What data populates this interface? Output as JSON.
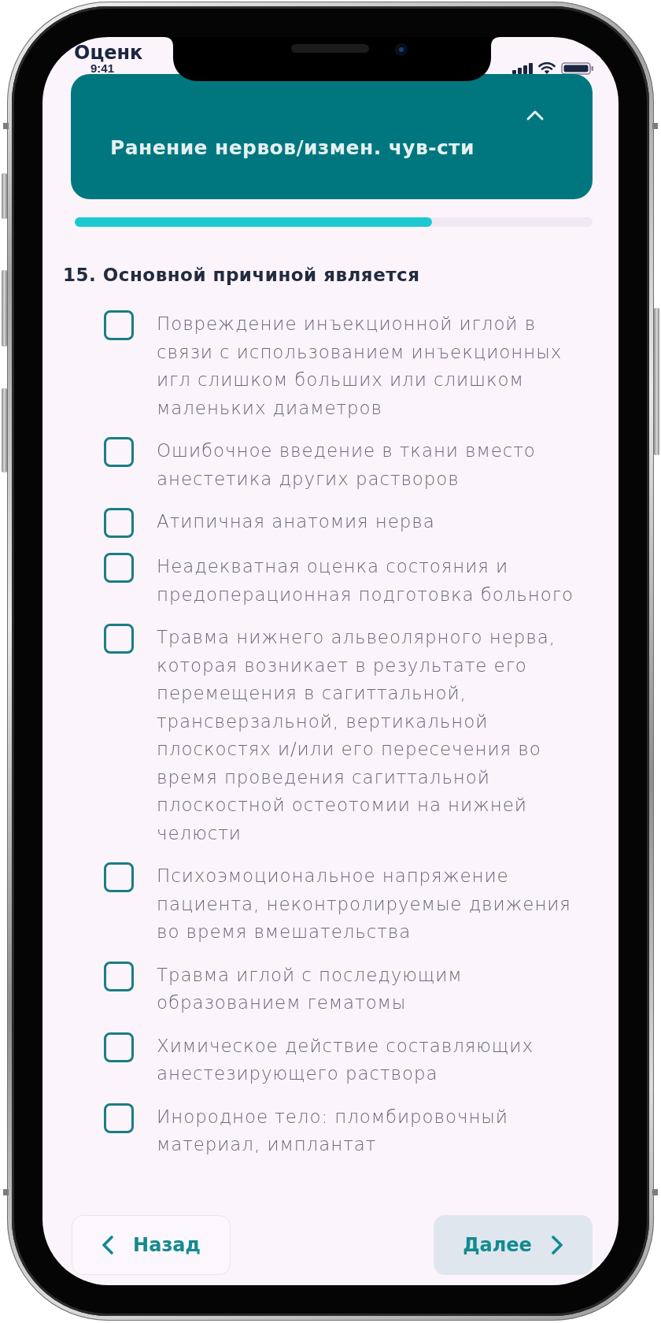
{
  "app_header": {
    "title": "Оценк"
  },
  "status_bar": {
    "time": "9:41"
  },
  "section": {
    "title": "Ранение нервов/измен. чув-сти",
    "expanded": true
  },
  "progress": {
    "level": 0.69
  },
  "question": {
    "text": "15. Основной причиной является",
    "options": [
      {
        "text": "Повреждение инъекционной иглой в связи с использованием инъекционных игл слишком больших или слишком маленьких диаметров",
        "checked": false
      },
      {
        "text": "Ошибочное введение в ткани вместо анестетика других растворов",
        "checked": false
      },
      {
        "text": "Атипичная анатомия нерва",
        "checked": false
      },
      {
        "text": "Неадекватная оценка состояния и предоперационная подготовка больного",
        "checked": false
      },
      {
        "text": "Травма нижнего альвеолярного нерва, которая возникает в результате его перемещения в сагиттальной, трансверзальной, вертикальной плоскостях и/или его пересечения во время проведения сагиттальной плоскостной остеотомии на нижней челюсти",
        "checked": false
      },
      {
        "text": "Психоэмоциональное напряжение пациента, неконтролируемые движения во время вмешательства",
        "checked": false
      },
      {
        "text": "Травма иглой с последующим образованием гематомы",
        "checked": false
      },
      {
        "text": "Химическое действие составляющих анестезирующего раствора",
        "checked": false
      },
      {
        "text": "Инородное тело: пломбировочный материал, имплантат",
        "checked": false
      }
    ]
  },
  "navigation": [
    {
      "kind": "back",
      "label": "Назад"
    },
    {
      "kind": "next",
      "label": "Далее"
    }
  ]
}
